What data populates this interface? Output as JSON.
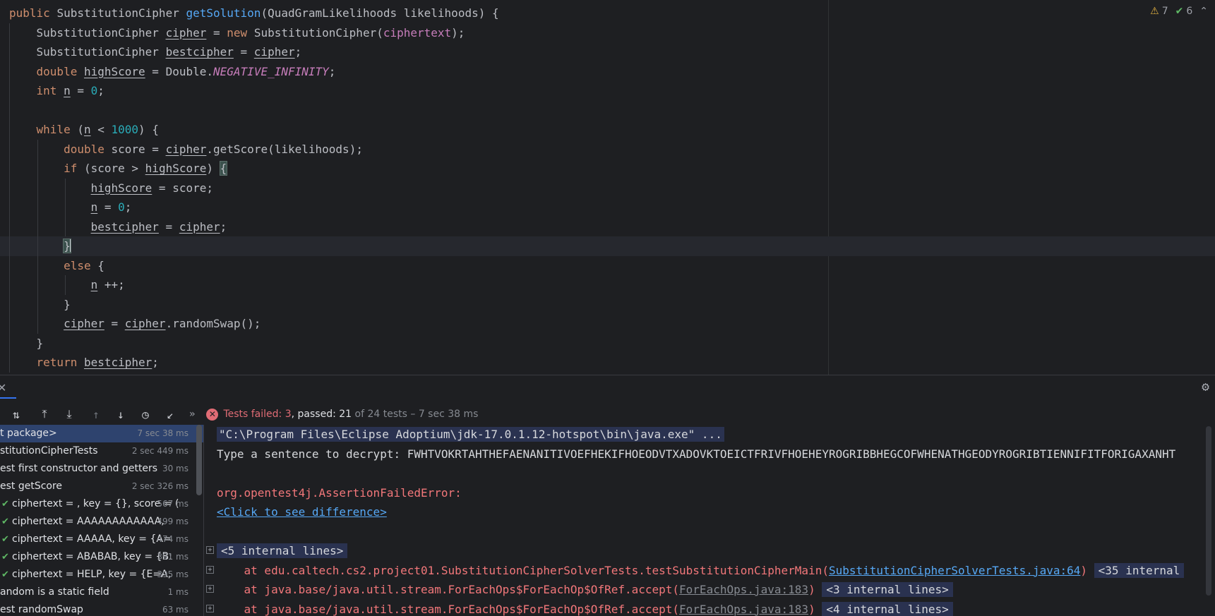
{
  "editor": {
    "inspections": {
      "warnings": "7",
      "checks": "6"
    },
    "tokens": {
      "public": "public",
      "class_type": "SubstitutionCipher",
      "method_name": "getSolution",
      "param_type": "QuadGramLikelihoods",
      "param_name": "likelihoods",
      "cipher": "cipher",
      "bestcipher": "bestcipher",
      "new": "new",
      "ciphertext": "ciphertext",
      "double": "double",
      "highScore": "highScore",
      "double_class": "Double",
      "neg_inf": "NEGATIVE_INFINITY",
      "int": "int",
      "n": "n",
      "zero": "0",
      "while": "while",
      "thousand": "1000",
      "score": "score",
      "getScore": "getScore",
      "if": "if",
      "else": "else",
      "randomSwap": "randomSwap",
      "return": "return"
    }
  },
  "toolwindow": {
    "status": {
      "failed_label": "Tests failed: 3",
      "passed_label": "passed: 21",
      "rest": "of 24 tests – 7 sec 38 ms"
    },
    "tree": [
      {
        "name": "t package>",
        "time": "7 sec 38 ms"
      },
      {
        "name": "stitutionCipherTests",
        "time": "2 sec 449 ms"
      },
      {
        "name": "est first constructor and getters",
        "time": "30 ms"
      },
      {
        "name": "est getScore",
        "time": "2 sec 326 ms"
      },
      {
        "name": "ciphertext = , key = {}, score = (",
        "time": "567 ms"
      },
      {
        "name": "ciphertext = AAAAAAAAAAAA,",
        "time": "499 ms"
      },
      {
        "name": "ciphertext = AAAAA, key = {A=",
        "time": "474 ms"
      },
      {
        "name": "ciphertext = ABABAB, key = {B:",
        "time": "391 ms"
      },
      {
        "name": "ciphertext = HELP, key = {E=A,",
        "time": "395 ms"
      },
      {
        "name": "andom is a static field",
        "time": "1 ms"
      },
      {
        "name": "est randomSwap",
        "time": "63 ms"
      }
    ],
    "console": {
      "cmd": "\"C:\\Program Files\\Eclipse Adoptium\\jdk-17.0.1.12-hotspot\\bin\\java.exe\" ...",
      "prompt": "Type a sentence to decrypt: FWHTVOKRTAHTHEFAENANITIVOEFHEKIFHOEODVTXADOVKTOEICTFRIVFHOEHEYROGRIBBHEGCOFWHENATHGEODYROGRIBTIENNIFITFORIGAXANHT",
      "error": "org.opentest4j.AssertionFailedError:",
      "diff_link": "<Click to see difference>",
      "internal5": "<5 internal lines>",
      "trace1_prefix": "    at edu.caltech.cs2.project01.SubstitutionCipherSolverTests.testSubstitutionCipherMain(",
      "trace1_link": "SubstitutionCipherSolverTests.java:64",
      "trace1_suffix": ")",
      "internal35": "<35 internal",
      "trace2_prefix": "    at java.base/java.util.stream.ForEachOps$ForEachOp$OfRef.accept(",
      "trace2_link": "ForEachOps.java:183",
      "trace2_suffix": ")",
      "internal3": "<3 internal lines>",
      "trace3_prefix": "    at java.base/java.util.stream.ForEachOps$ForEachOp$OfRef.accept(",
      "trace3_link": "ForEachOps.java:183",
      "trace3_suffix": ")",
      "internal4": "<4 internal lines>"
    }
  }
}
